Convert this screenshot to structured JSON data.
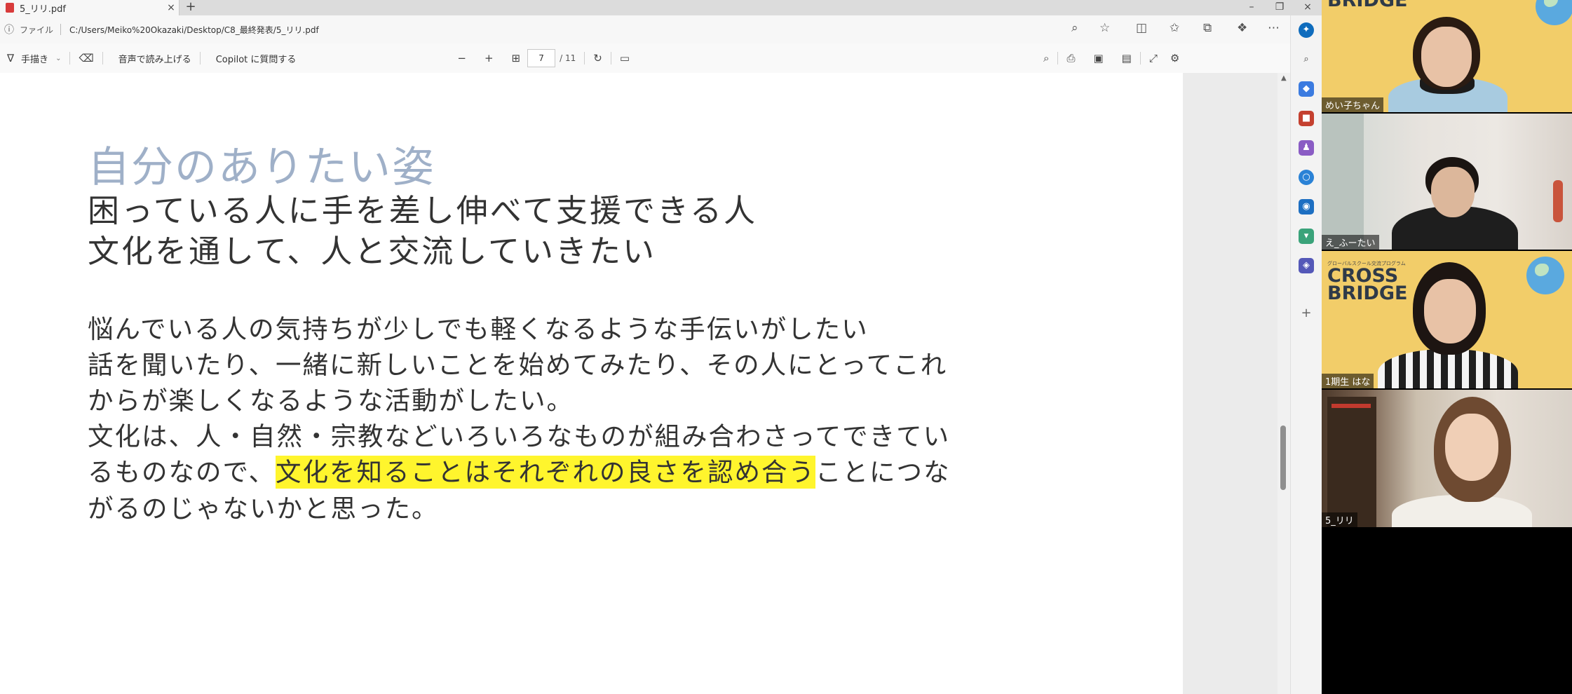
{
  "browser": {
    "tab_title": "5_リリ.pdf",
    "tab_close": "×",
    "new_tab": "+",
    "window_controls": {
      "minimize": "–",
      "restore": "❐",
      "close": "×"
    },
    "address_label": "ファイル",
    "url": "C:/Users/Meiko%20Okazaki/Desktop/C8_最終発表/5_リリ.pdf"
  },
  "pdf_toolbar": {
    "draw_label": "手描き",
    "read_aloud_label": "音声で読み上げる",
    "copilot_label": "Copilot に質問する",
    "zoom_out": "−",
    "zoom_in": "+",
    "current_page": "7",
    "total_pages": "/ 11"
  },
  "slide": {
    "title": "自分のありたい姿",
    "headline_1": "困っている人に手を差し伸べて支援できる人",
    "headline_2": "文化を通して、人と交流していきたい",
    "body_1": "悩んでいる人の気持ちが少しでも軽くなるような手伝いがしたい",
    "body_2": "話を聞いたり、一緒に新しいことを始めてみたり、その人にとってこれ",
    "body_3": "からが楽しくなるような活動がしたい。",
    "body_4": "文化は、人・自然・宗教などいろいろなものが組み合わさってできてい",
    "body_5_pre": "るものなので、",
    "body_5_highlight": "文化を知ることはそれぞれの良さを認め合う",
    "body_5_post": "ことにつな",
    "body_6": "がるのじゃないかと思った。",
    "highlight_color": "#fff52d"
  },
  "video_call": {
    "participants": [
      {
        "name": "めい子ちゃん"
      },
      {
        "name": "え_ふーたい"
      },
      {
        "name": "1期生 はな"
      },
      {
        "name": "5_リリ"
      }
    ],
    "brand_line1": "CROSS",
    "brand_line2": "BRIDGE",
    "brand_small": "グローバルスクール交流プログラム"
  },
  "colors": {
    "accent_edge": "#0f6cbd",
    "slide_title": "#9fb0c8",
    "tile_bg_yellow": "#f2cd69"
  }
}
